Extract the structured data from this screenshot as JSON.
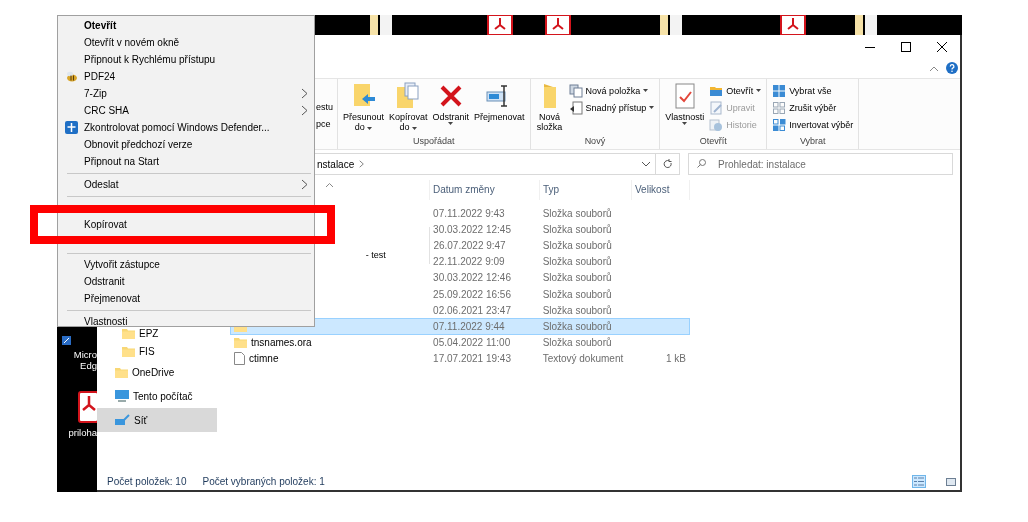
{
  "desktop": {
    "shortcuts": [
      {
        "kind": "browser",
        "label_lines": [
          "Micro",
          "Edg"
        ]
      },
      {
        "kind": "pdf",
        "label_lines": [
          "priloha"
        ]
      }
    ]
  },
  "window": {
    "ribbon": {
      "cut_labels": [
        "estu",
        "pce"
      ],
      "groups": [
        {
          "label": "Uspořádat",
          "large": [
            {
              "kind": "move",
              "lines": [
                "Přesunout",
                "do"
              ],
              "dropdown": true
            },
            {
              "kind": "copy",
              "lines": [
                "Kopírovat",
                "do"
              ],
              "dropdown": true
            },
            {
              "kind": "delete",
              "lines": [
                "Odstranit"
              ],
              "dropdown": true
            },
            {
              "kind": "rename",
              "lines": [
                "Přejmenovat"
              ],
              "dropdown": false
            }
          ]
        },
        {
          "label": "Nový",
          "large": [
            {
              "kind": "new_folder",
              "lines": [
                "Nová",
                "složka"
              ],
              "dropdown": false
            }
          ],
          "small": [
            {
              "kind": "new_item",
              "label": "Nová položka",
              "dropdown": true,
              "disabled": false
            },
            {
              "kind": "easy_access",
              "label": "Snadný přístup",
              "dropdown": true,
              "disabled": false
            }
          ]
        },
        {
          "label": "Otevřít",
          "large": [
            {
              "kind": "properties",
              "lines": [
                "Vlastnosti"
              ],
              "dropdown": true
            }
          ],
          "small": [
            {
              "kind": "open",
              "label": "Otevřít",
              "dropdown": true,
              "disabled": false
            },
            {
              "kind": "edit",
              "label": "Upravit",
              "dropdown": false,
              "disabled": true
            },
            {
              "kind": "history",
              "label": "Historie",
              "dropdown": false,
              "disabled": true
            }
          ]
        },
        {
          "label": "Vybrat",
          "small": [
            {
              "kind": "select_all",
              "label": "Vybrat vše",
              "dropdown": false,
              "disabled": false
            },
            {
              "kind": "select_none",
              "label": "Zrušit výběr",
              "dropdown": false,
              "disabled": false
            },
            {
              "kind": "invert",
              "label": "Invertovat výběr",
              "dropdown": false,
              "disabled": false
            }
          ]
        }
      ]
    },
    "address": {
      "path": "nstalace"
    },
    "search": {
      "placeholder": "Prohledat: instalace"
    },
    "nav": {
      "partial_children": [
        {
          "label": "EPZ",
          "selected": false
        },
        {
          "label": "FIS",
          "selected": false
        }
      ],
      "items": [
        {
          "label": "OneDrive",
          "kind": "onedrive",
          "selected": false
        },
        {
          "label": "Tento počítač",
          "kind": "computer",
          "selected": false
        },
        {
          "label": "Síť",
          "kind": "network",
          "selected": true
        }
      ]
    },
    "files": {
      "columns": [
        "Datum změny",
        "Typ",
        "Velikost"
      ],
      "rows": [
        {
          "date": "07.11.2022 9:43",
          "type": "Složka souborů",
          "selected": false
        },
        {
          "date": "30.03.2022 12:45",
          "type": "Složka souborů",
          "selected": false
        },
        {
          "name": "- test",
          "cut_left": true,
          "date": "26.07.2022 9:47",
          "type": "Složka souborů",
          "selected": false
        },
        {
          "date": "22.11.2022 9:09",
          "type": "Složka souborů",
          "selected": false
        },
        {
          "date": "30.03.2022 12:46",
          "type": "Složka souborů",
          "selected": false
        },
        {
          "date": "25.09.2022 16:56",
          "type": "Složka souborů",
          "selected": false
        },
        {
          "date": "02.06.2021 23:47",
          "type": "Složka souborů",
          "selected": false
        },
        {
          "kind": "folder",
          "date": "07.11.2022 9:44",
          "type": "Složka souborů",
          "selected": true
        },
        {
          "kind": "folder",
          "name": "tnsnames.ora",
          "date": "05.04.2022 11:00",
          "type": "Složka souborů",
          "selected": false
        },
        {
          "kind": "text",
          "name": "ctimne",
          "date": "17.07.2021 19:43",
          "type": "Textový dokument",
          "size": "1 kB",
          "selected": false
        }
      ]
    },
    "status_bar": [
      "Počet položek: 10",
      "Počet vybraných položek: 1"
    ],
    "view_buttons": [
      {
        "selected": true
      },
      {
        "selected": false
      }
    ]
  },
  "context_menu": {
    "items": [
      {
        "kind": "plain",
        "label": "Otevřít",
        "bold": true,
        "submenu": false
      },
      {
        "kind": "plain",
        "label": "Otevřít v novém okně",
        "bold": false,
        "submenu": false
      },
      {
        "kind": "plain",
        "label": "Připnout k Rychlému přístupu",
        "bold": false,
        "submenu": false
      },
      {
        "kind": "pdf24",
        "label": "PDF24",
        "bold": false,
        "submenu": false
      },
      {
        "kind": "plain",
        "label": "7-Zip",
        "bold": false,
        "submenu": true
      },
      {
        "kind": "plain",
        "label": "CRC SHA",
        "bold": false,
        "submenu": true
      },
      {
        "kind": "defender",
        "label": "Zkontrolovat pomocí Windows Defender...",
        "bold": false,
        "submenu": false
      },
      {
        "kind": "plain",
        "label": "Obnovit předchozí verze",
        "bold": false,
        "submenu": false
      },
      {
        "kind": "plain",
        "label": "Připnout na Start",
        "bold": false,
        "submenu": false
      },
      {
        "kind": "separator"
      },
      {
        "kind": "plain",
        "label": "Odeslat",
        "bold": false,
        "submenu": true
      },
      {
        "kind": "separator"
      },
      {
        "kind": "blank"
      },
      {
        "kind": "plain",
        "label": "Kopírovat",
        "bold": false,
        "submenu": false
      },
      {
        "kind": "blank"
      },
      {
        "kind": "separator"
      },
      {
        "kind": "plain",
        "label": "Vytvořit zástupce",
        "bold": false,
        "submenu": false
      },
      {
        "kind": "plain",
        "label": "Odstranit",
        "bold": false,
        "submenu": false
      },
      {
        "kind": "plain",
        "label": "Přejmenovat",
        "bold": false,
        "submenu": false
      },
      {
        "kind": "separator"
      },
      {
        "kind": "plain",
        "label": "Vlastnosti",
        "bold": false,
        "submenu": false
      }
    ]
  },
  "annotation": {
    "kind": "highlight_frame"
  }
}
